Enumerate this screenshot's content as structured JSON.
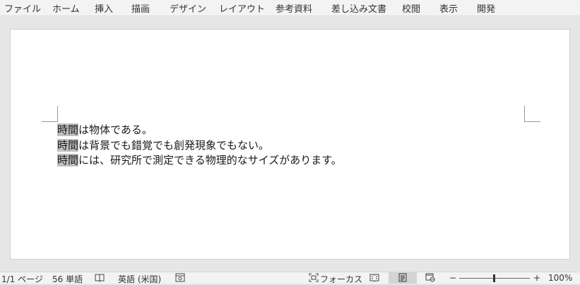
{
  "ribbon": {
    "tabs": [
      "ファイル",
      "ホーム",
      "挿入",
      "描画",
      "デザイン",
      "レイアウト",
      "参考資料",
      "差し込み文書",
      "校閲",
      "表示",
      "開発"
    ]
  },
  "document": {
    "highlight_word": "時間",
    "lines": [
      {
        "highlight": "時間",
        "rest": "は物体である。"
      },
      {
        "highlight": "時間",
        "rest": "は背景でも錯覚でも創発現象でもない。"
      },
      {
        "highlight": "時間",
        "rest": "には、研究所で測定できる物理的なサイズがあります。"
      }
    ]
  },
  "status": {
    "page": "1/1 ページ",
    "words": "56 単語",
    "language": "英語 (米国)",
    "focus": "フォーカス",
    "zoom_minus": "−",
    "zoom_plus": "+",
    "zoom": "100%",
    "zoom_level_percent": 100
  },
  "colors": {
    "highlight": "#bfbfbf",
    "ribbon_bg": "#f3f3f3",
    "workspace_bg": "#e6e6e6"
  }
}
